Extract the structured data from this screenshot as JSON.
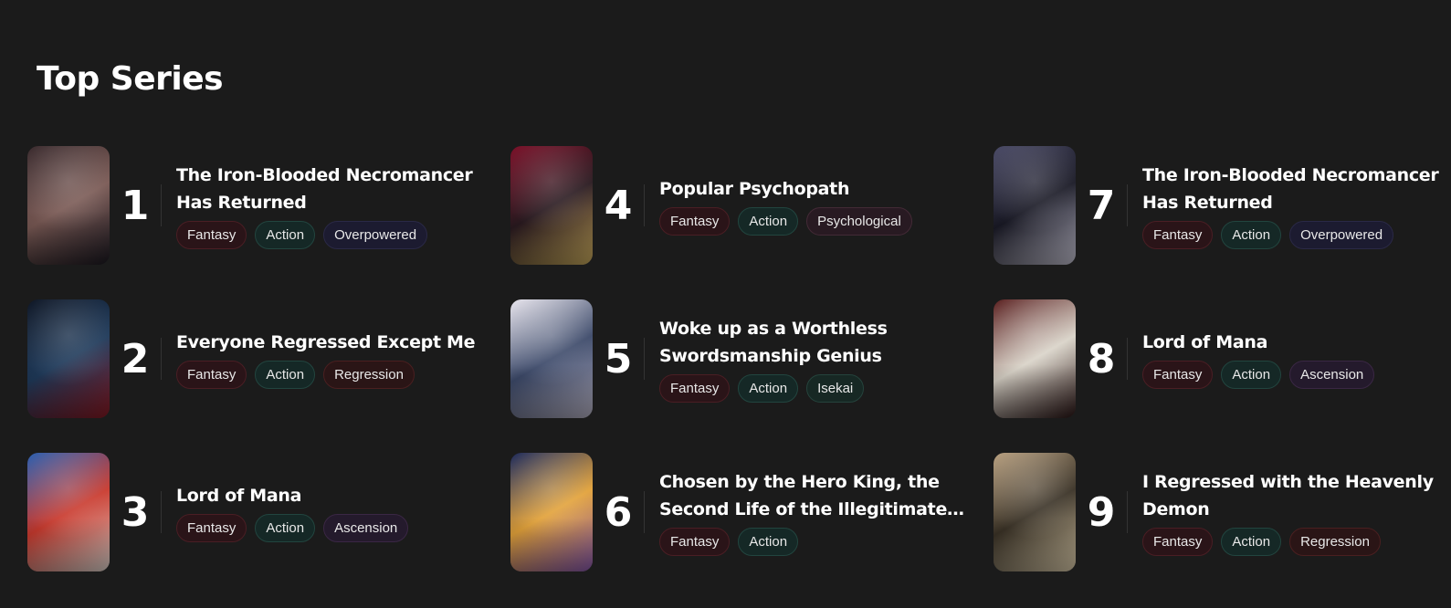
{
  "section": {
    "title": "Top Series"
  },
  "series": [
    {
      "rank": "1",
      "title": "The Iron-Blooded Necromancer Has Returned",
      "tags": [
        "Fantasy",
        "Action",
        "Overpowered"
      ],
      "cover_colors": [
        "#3a2b2e",
        "#7a5a55",
        "#1d1a22"
      ]
    },
    {
      "rank": "2",
      "title": "Everyone Regressed Except Me",
      "tags": [
        "Fantasy",
        "Action",
        "Regression"
      ],
      "cover_colors": [
        "#0f1726",
        "#1f3a5a",
        "#8a1a24"
      ]
    },
    {
      "rank": "3",
      "title": "Lord of Mana",
      "tags": [
        "Fantasy",
        "Action",
        "Ascension"
      ],
      "cover_colors": [
        "#2a5fb0",
        "#c93a2e",
        "#e3d9d2"
      ]
    },
    {
      "rank": "4",
      "title": "Popular Psychopath",
      "tags": [
        "Fantasy",
        "Action",
        "Psychological"
      ],
      "cover_colors": [
        "#7a1028",
        "#2a1a20",
        "#d0b060"
      ]
    },
    {
      "rank": "5",
      "title": "Woke up as a Worthless Swordsmanship Genius",
      "tags": [
        "Fantasy",
        "Action",
        "Isekai"
      ],
      "cover_colors": [
        "#e9e6ee",
        "#3d4a6a",
        "#b8b4c6"
      ]
    },
    {
      "rank": "6",
      "title": "Chosen by the Hero King, the Second Life of the Illegitimate…",
      "tags": [
        "Fantasy",
        "Action"
      ],
      "cover_colors": [
        "#1c2a5c",
        "#e2a23a",
        "#8a5ab0"
      ]
    },
    {
      "rank": "7",
      "title": "The Iron-Blooded Necromancer Has Returned",
      "tags": [
        "Fantasy",
        "Action",
        "Overpowered"
      ],
      "cover_colors": [
        "#4a4a66",
        "#1a1a26",
        "#c8c6d6"
      ]
    },
    {
      "rank": "8",
      "title": "Lord of Mana",
      "tags": [
        "Fantasy",
        "Action",
        "Ascension"
      ],
      "cover_colors": [
        "#5a2020",
        "#d9d3c8",
        "#2a1616"
      ]
    },
    {
      "rank": "9",
      "title": "I Regressed with the Heavenly Demon",
      "tags": [
        "Fantasy",
        "Action",
        "Regression"
      ],
      "cover_colors": [
        "#b8a080",
        "#3a3226",
        "#e2d2b0"
      ]
    }
  ],
  "tag_styles": {
    "Fantasy": "tag-fantasy",
    "Action": "tag-action",
    "Overpowered": "tag-overpowered",
    "Regression": "tag-regression",
    "Ascension": "tag-ascension",
    "Psychological": "tag-psychological",
    "Isekai": "tag-isekai"
  }
}
